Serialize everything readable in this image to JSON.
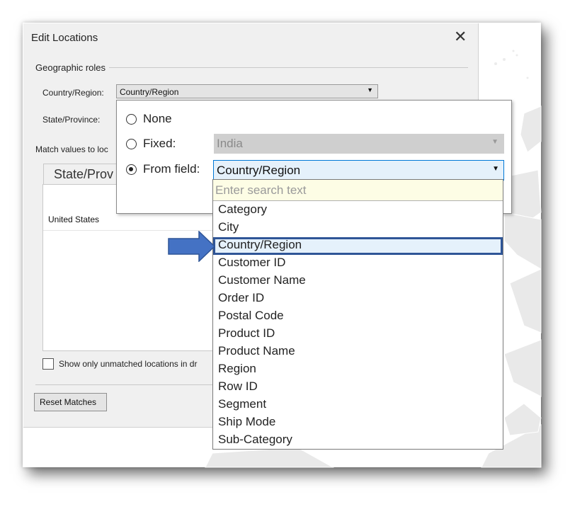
{
  "dialog": {
    "title": "Edit Locations",
    "close_glyph": "✕",
    "geographic_roles_label": "Geographic roles",
    "country_region_label": "Country/Region:",
    "country_region_value": "Country/Region",
    "state_province_label": "State/Province:",
    "match_values_label": "Match values to loc",
    "tab_label": "State/Prov",
    "grid_first_cell": "United States",
    "show_unmatched_label": "Show only unmatched locations in dr",
    "reset_button_label": "Reset Matches"
  },
  "popup": {
    "options": [
      {
        "label": "None",
        "checked": false
      },
      {
        "label": "Fixed:",
        "checked": false
      },
      {
        "label": "From field:",
        "checked": true
      }
    ],
    "fixed_value": "India",
    "field_value": "Country/Region",
    "search_placeholder": "Enter search text",
    "fields": [
      "Category",
      "City",
      "Country/Region",
      "Customer ID",
      "Customer Name",
      "Order ID",
      "Postal Code",
      "Product ID",
      "Product Name",
      "Region",
      "Row ID",
      "Segment",
      "Ship Mode",
      "Sub-Category"
    ],
    "selected_field": "Country/Region"
  },
  "colors": {
    "accent": "#0078d7",
    "highlight_border": "#2f5597",
    "callout_arrow": "#4472c4"
  },
  "icons": {
    "close": "close-icon",
    "dropdown": "chevron-down-icon",
    "callout": "arrow-right-icon"
  }
}
